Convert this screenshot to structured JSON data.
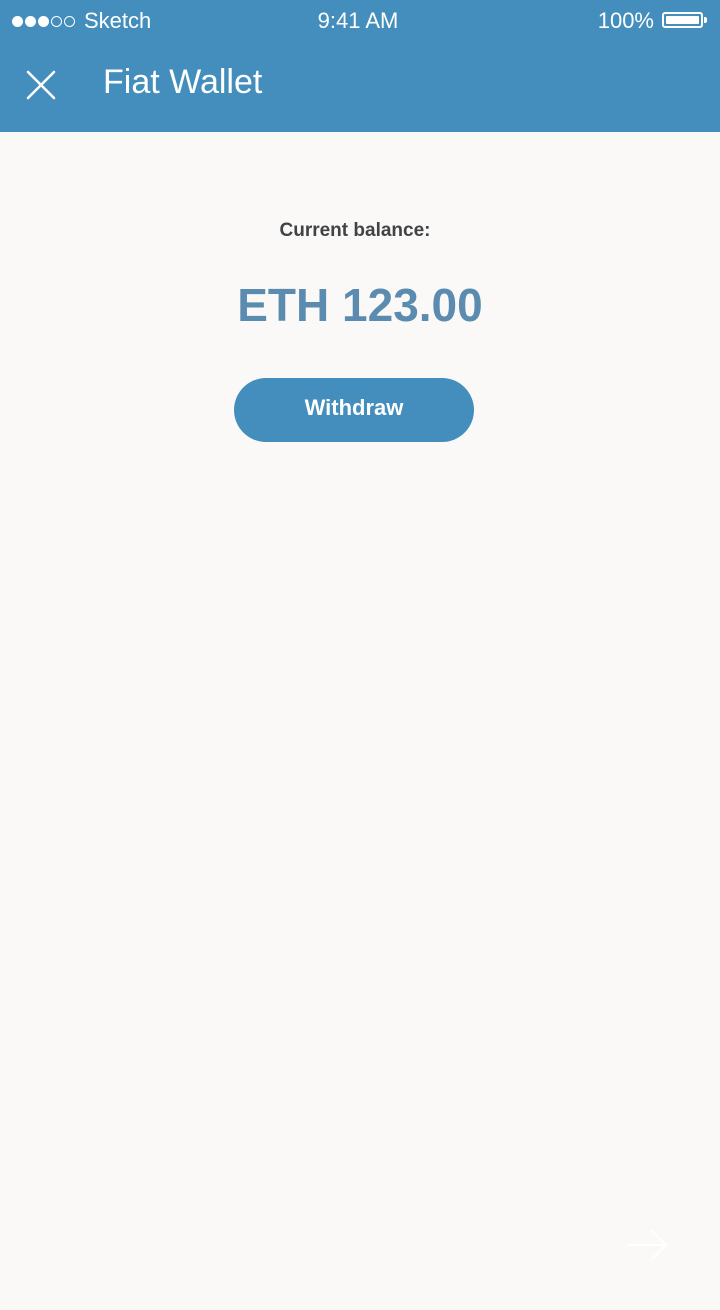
{
  "status_bar": {
    "signal_bars_filled": 3,
    "signal_bars_total": 5,
    "carrier": "Sketch",
    "time": "9:41 AM",
    "battery_percent": "100%",
    "battery_level": 1.0
  },
  "header": {
    "title": "Fiat Wallet",
    "close_icon": "close-icon",
    "background_color": "#438EBC"
  },
  "balance": {
    "label": "Current balance:",
    "amount": "ETH 123.00"
  },
  "actions": {
    "withdraw_label": "Withdraw"
  },
  "footer": {
    "next_icon": "arrow-right-icon"
  },
  "colors": {
    "accent": "#438EBC",
    "balance_text": "#5B8CAF",
    "background": "#FAF9F7"
  }
}
